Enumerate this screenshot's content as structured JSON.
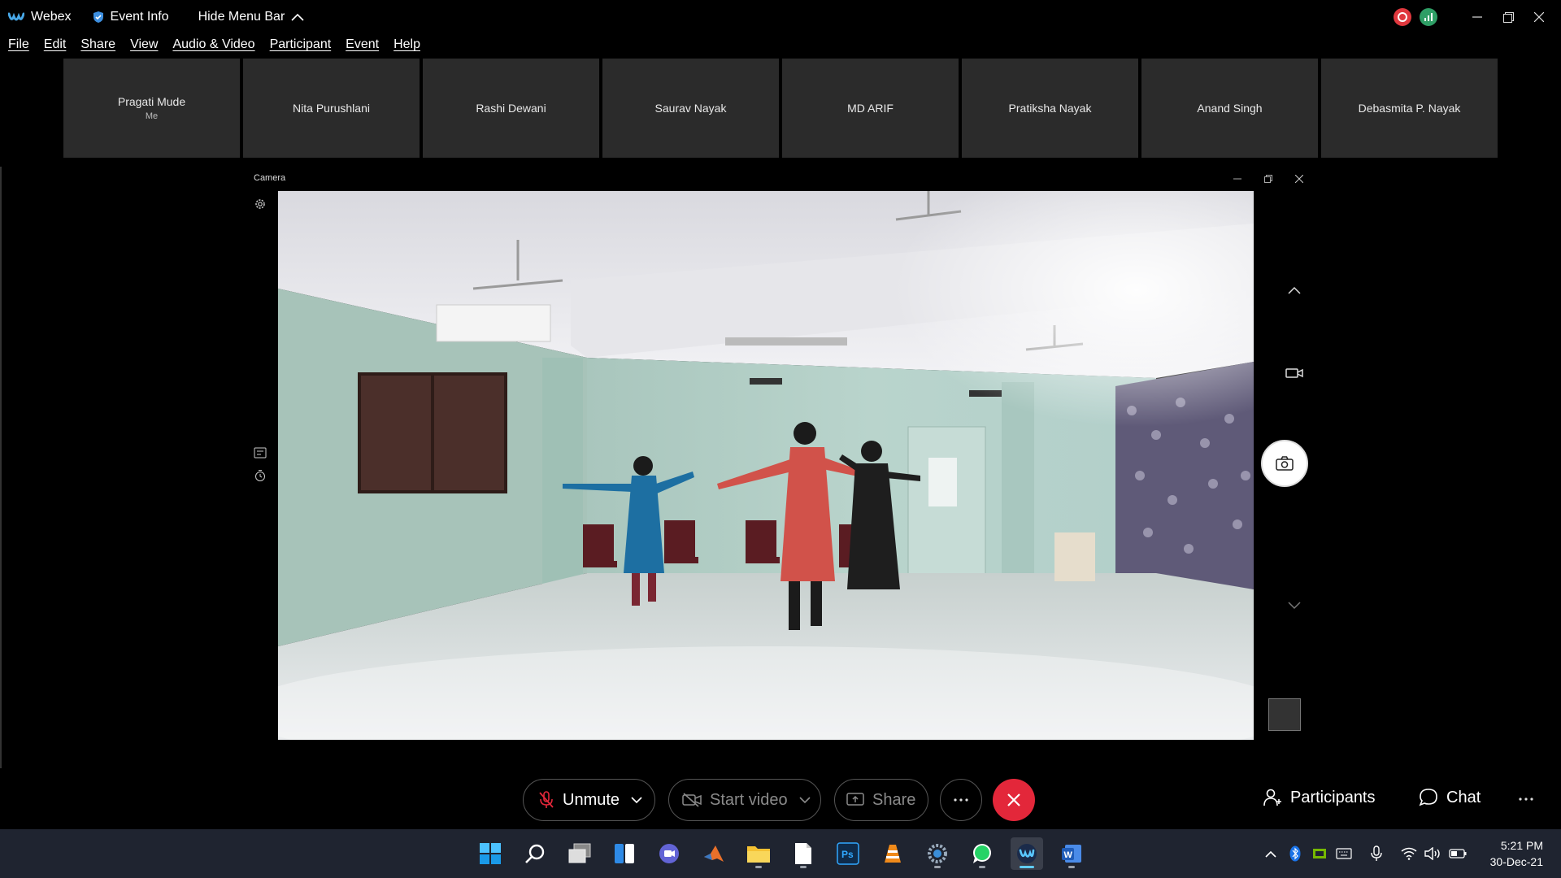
{
  "titlebar": {
    "app_name": "Webex",
    "event_info": "Event Info",
    "hide_menu": "Hide Menu Bar",
    "colors": {
      "record": "#e0383e",
      "stats": "#2e9e65"
    }
  },
  "menu": [
    "File",
    "Edit",
    "Share",
    "View",
    "Audio & Video",
    "Participant",
    "Event",
    "Help"
  ],
  "participants": [
    {
      "name": "Pragati Mude",
      "sub": "Me"
    },
    {
      "name": "Nita Purushlani"
    },
    {
      "name": "Rashi Dewani"
    },
    {
      "name": "Saurav Nayak"
    },
    {
      "name": "MD ARIF"
    },
    {
      "name": "Pratiksha Nayak"
    },
    {
      "name": "Anand Singh"
    },
    {
      "name": "Debasmita P. Nayak"
    }
  ],
  "camera": {
    "title": "Camera"
  },
  "controls": {
    "unmute": "Unmute",
    "start_video": "Start video",
    "share": "Share",
    "participants": "Participants",
    "chat": "Chat",
    "end_color": "#e3273a"
  },
  "taskbar": {
    "icons": [
      "windows-start",
      "search",
      "task-view",
      "widgets",
      "teams-chat",
      "matlab",
      "file-explorer",
      "notepad",
      "photoshop",
      "vlc",
      "settings",
      "whatsapp",
      "webex",
      "word"
    ],
    "time": "5:21 PM",
    "date": "30-Dec-21"
  }
}
